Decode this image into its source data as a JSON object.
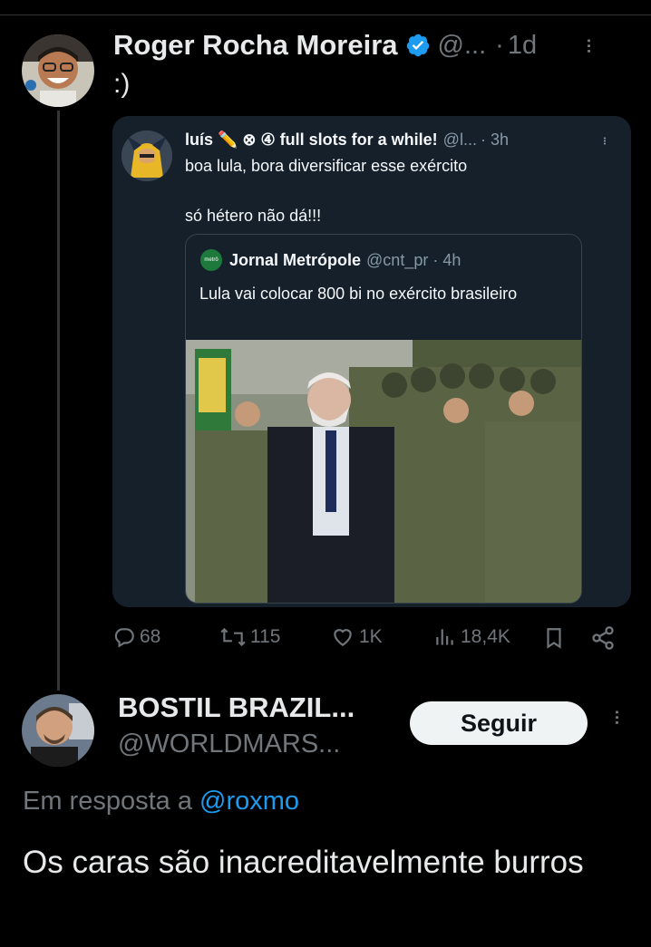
{
  "tweet": {
    "author_name": "Roger Rocha Moreira",
    "author_handle": "@...",
    "time_sep": "·",
    "time": "1d",
    "text": ":)",
    "more_glyph": "...",
    "stats": {
      "replies": "68",
      "retweets": "115",
      "likes": "1K",
      "views": "18,4K"
    }
  },
  "quote": {
    "author_name": "luís ✏️ ⊗ ④ full slots for a while!",
    "author_handle": "@l...",
    "time": "· 3h",
    "text_line1": "boa lula, bora diversificar esse exército",
    "text_line2": "só hétero não dá!!!",
    "more_glyph": "...",
    "inner": {
      "logo_text": "metrô",
      "author_name": "Jornal Metrópole",
      "author_handle": "@cnt_pr · 4h",
      "text": "Lula vai colocar 800 bi no exército brasileiro"
    }
  },
  "reply": {
    "author_name": "BOSTIL BRAZIL...",
    "author_handle": "@WORLDMARS...",
    "follow_label": "Seguir",
    "more_glyph": "...",
    "reply_to_label": "Em resposta a",
    "reply_to_mention": "@roxmo",
    "text": "Os caras são inacreditavelmente burros"
  },
  "icons": {
    "verified": "verified-badge-icon",
    "reply": "reply-icon",
    "retweet": "retweet-icon",
    "like": "like-icon",
    "views": "views-icon",
    "bookmark": "bookmark-icon",
    "share": "share-icon"
  },
  "colors": {
    "background": "#000000",
    "accent": "#1d9bf0",
    "muted": "#71767b",
    "quote_bg": "#15202b"
  }
}
